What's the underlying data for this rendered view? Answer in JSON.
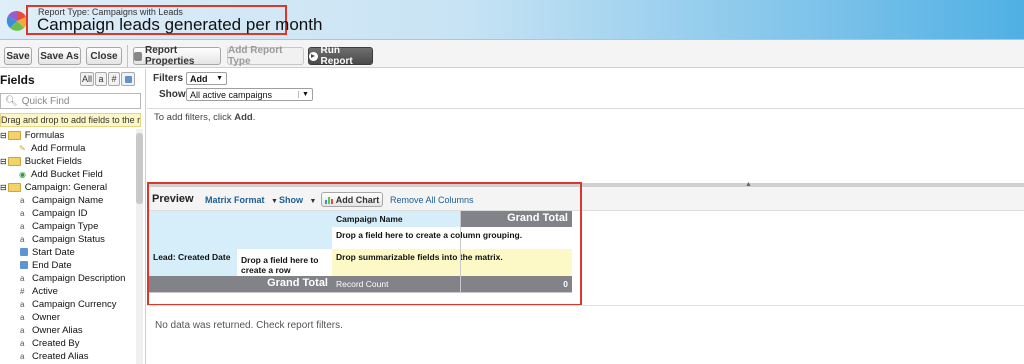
{
  "header": {
    "report_type": "Report Type: Campaigns with Leads",
    "title": "Campaign leads generated per month"
  },
  "toolbar": {
    "save": "Save",
    "save_as": "Save As",
    "close": "Close",
    "report_properties": "Report Properties",
    "add_report_type": "Add Report Type",
    "run_report": "Run Report"
  },
  "sidebar": {
    "title": "Fields",
    "filter_all": "All",
    "filter_text": "a",
    "filter_num": "#",
    "quick_find_placeholder": "Quick Find",
    "drag_hint": "Drag and drop to add fields to the report.",
    "items": [
      {
        "label": "Formulas",
        "icon": "folder-icon"
      },
      {
        "label": "Add Formula",
        "icon": "formula-icon"
      },
      {
        "label": "Bucket Fields",
        "icon": "folder-icon"
      },
      {
        "label": "Add Bucket Field",
        "icon": "bucket-icon"
      },
      {
        "label": "Campaign: General",
        "icon": "folder-icon"
      },
      {
        "label": "Campaign Name",
        "icon": "text-field-icon"
      },
      {
        "label": "Campaign ID",
        "icon": "text-field-icon"
      },
      {
        "label": "Campaign Type",
        "icon": "text-field-icon"
      },
      {
        "label": "Campaign Status",
        "icon": "text-field-icon"
      },
      {
        "label": "Start Date",
        "icon": "date-field-icon"
      },
      {
        "label": "End Date",
        "icon": "date-field-icon"
      },
      {
        "label": "Campaign Description",
        "icon": "text-field-icon"
      },
      {
        "label": "Active",
        "icon": "number-field-icon"
      },
      {
        "label": "Campaign Currency",
        "icon": "text-field-icon"
      },
      {
        "label": "Owner",
        "icon": "text-field-icon"
      },
      {
        "label": "Owner Alias",
        "icon": "text-field-icon"
      },
      {
        "label": "Created By",
        "icon": "text-field-icon"
      },
      {
        "label": "Created Alias",
        "icon": "text-field-icon"
      }
    ]
  },
  "filters": {
    "title": "Filters",
    "add_label": "Add",
    "show_label": "Show",
    "show_value": "All active campaigns",
    "hint_prefix": "To add filters, click ",
    "hint_link": "Add",
    "hint_suffix": "."
  },
  "preview": {
    "title": "Preview",
    "format": "Matrix Format",
    "show": "Show",
    "add_chart": "Add Chart",
    "remove_all": "Remove All Columns",
    "col_field": "Campaign Name",
    "grand_total_col": "Grand Total",
    "drop_column": "Drop a field here to create a column grouping.",
    "row_field": "Lead: Created Date",
    "drop_row": "Drop a field here to create a row grouping.",
    "drop_summary": "Drop summarizable fields into the matrix.",
    "grand_total_row": "Grand Total",
    "record_count": "Record Count",
    "total_value": "0",
    "no_data": "No data was returned. Check report filters."
  }
}
